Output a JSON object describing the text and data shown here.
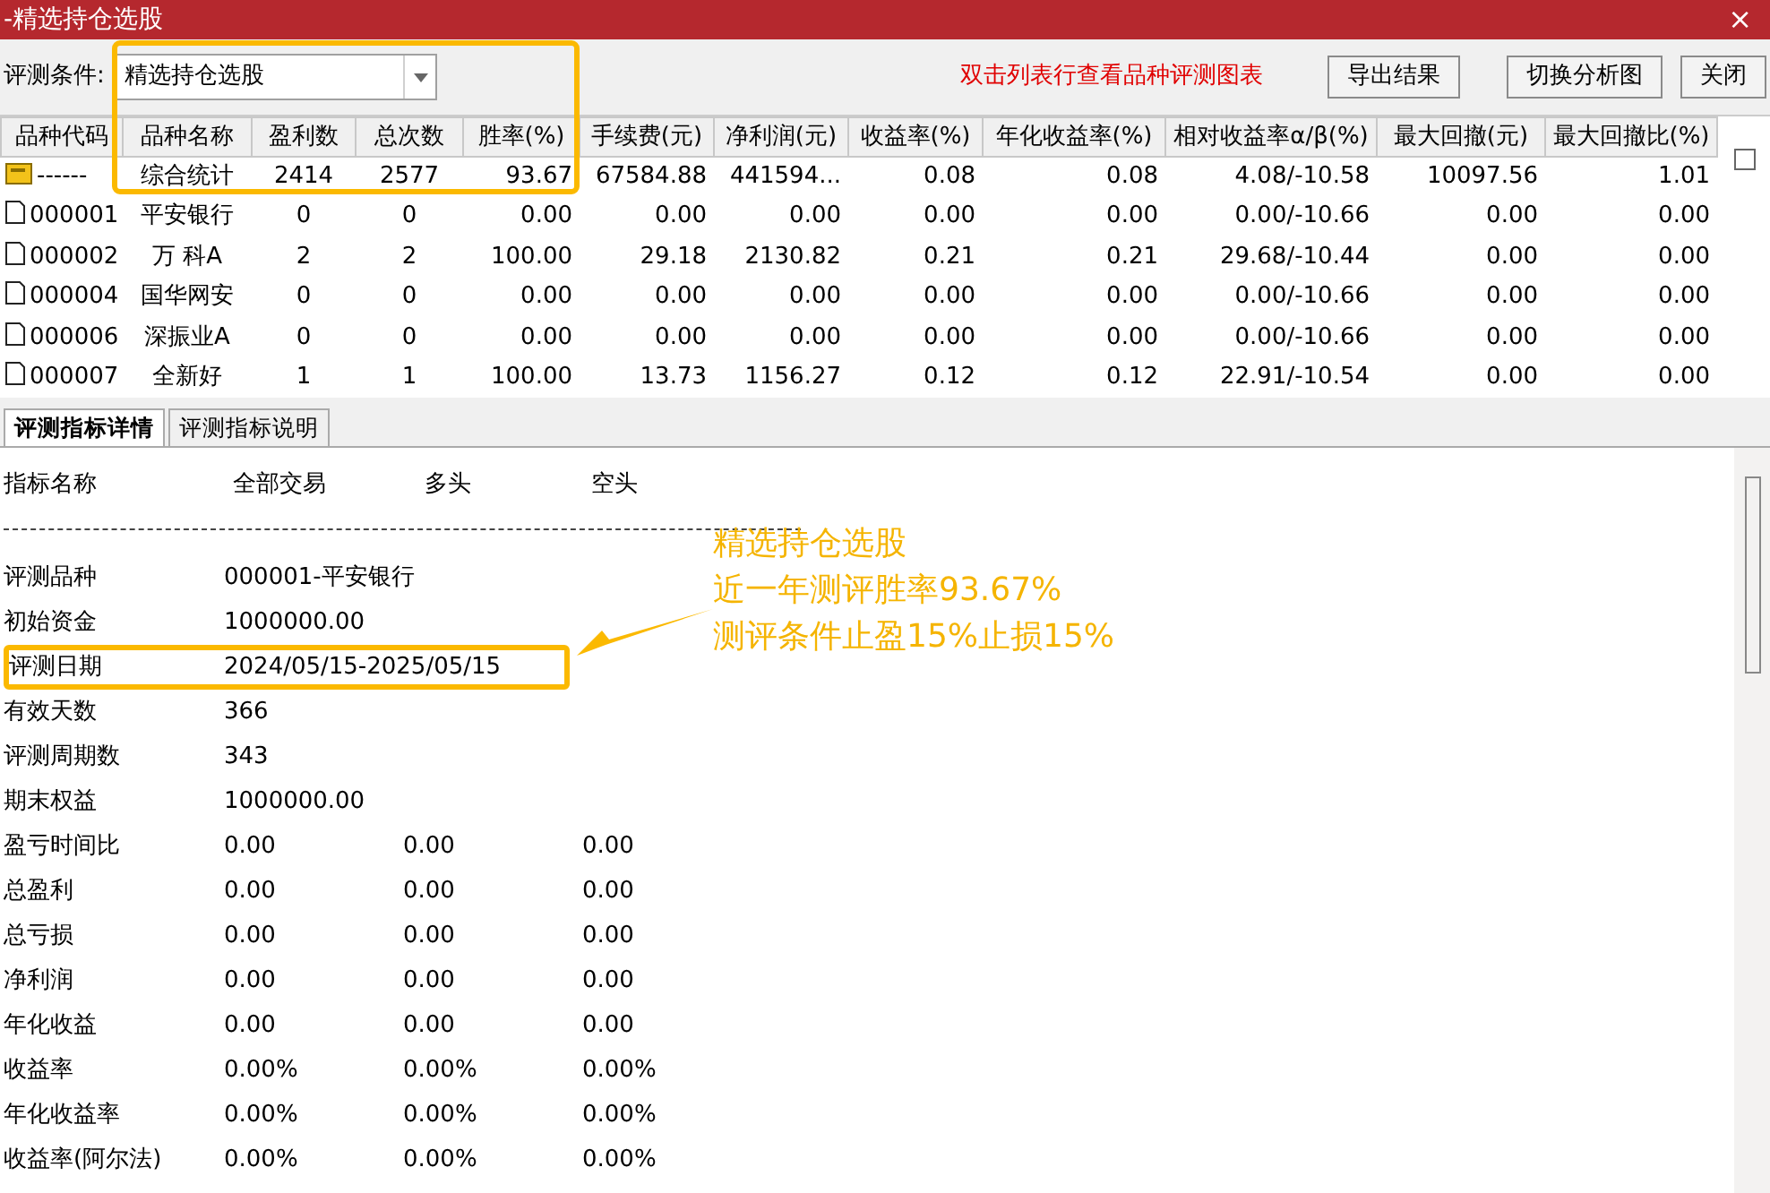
{
  "window": {
    "title": "-精选持仓选股",
    "close": "×"
  },
  "toolbar": {
    "condition_label": "评测条件:",
    "condition_value": "精选持仓选股",
    "hint": "双击列表行查看品种评测图表",
    "buttons": [
      "导出结果",
      "切换分析图",
      "关闭"
    ]
  },
  "table": {
    "columns": [
      "品种代码",
      "品种名称",
      "盈利数",
      "总次数",
      "胜率(%)",
      "手续费(元)",
      "净利润(元)",
      "收益率(%)",
      "年化收益率(%)",
      "相对收益率α/β(%)",
      "最大回撤(元)",
      "最大回撤比(%)"
    ],
    "checkbox_checked": false,
    "rows": [
      {
        "kind": "summary",
        "cells": [
          "------",
          "综合统计",
          "2414",
          "2577",
          "93.67",
          "67584.88",
          "441594...",
          "0.08",
          "0.08",
          "4.08/-10.58",
          "10097.56",
          "1.01"
        ]
      },
      {
        "kind": "stock",
        "cells": [
          "000001",
          "平安银行",
          "0",
          "0",
          "0.00",
          "0.00",
          "0.00",
          "0.00",
          "0.00",
          "0.00/-10.66",
          "0.00",
          "0.00"
        ]
      },
      {
        "kind": "stock",
        "cells": [
          "000002",
          "万 科A",
          "2",
          "2",
          "100.00",
          "29.18",
          "2130.82",
          "0.21",
          "0.21",
          "29.68/-10.44",
          "0.00",
          "0.00"
        ]
      },
      {
        "kind": "stock",
        "cells": [
          "000004",
          "国华网安",
          "0",
          "0",
          "0.00",
          "0.00",
          "0.00",
          "0.00",
          "0.00",
          "0.00/-10.66",
          "0.00",
          "0.00"
        ]
      },
      {
        "kind": "stock",
        "cells": [
          "000006",
          "深振业A",
          "0",
          "0",
          "0.00",
          "0.00",
          "0.00",
          "0.00",
          "0.00",
          "0.00/-10.66",
          "0.00",
          "0.00"
        ]
      },
      {
        "kind": "stock",
        "cells": [
          "000007",
          "全新好",
          "1",
          "1",
          "100.00",
          "13.73",
          "1156.27",
          "0.12",
          "0.12",
          "22.91/-10.54",
          "0.00",
          "0.00"
        ]
      }
    ]
  },
  "tabs": [
    {
      "label": "评测指标详情",
      "selected": true
    },
    {
      "label": "评测指标说明",
      "selected": false
    }
  ],
  "details": {
    "header": [
      "指标名称",
      "全部交易",
      "多头",
      "空头"
    ],
    "rows": [
      {
        "label": "评测品种",
        "values": [
          "000001-平安银行"
        ]
      },
      {
        "label": "初始资金",
        "values": [
          "1000000.00"
        ]
      },
      {
        "label": "评测日期",
        "values": [
          "2024/05/15-2025/05/15"
        ],
        "highlighted": true
      },
      {
        "label": "有效天数",
        "values": [
          "366"
        ]
      },
      {
        "label": "评测周期数",
        "values": [
          "343"
        ]
      },
      {
        "label": "期末权益",
        "values": [
          "1000000.00"
        ]
      },
      {
        "label": "盈亏时间比",
        "values": [
          "0.00",
          "0.00",
          "0.00"
        ]
      },
      {
        "label": "总盈利",
        "values": [
          "0.00",
          "0.00",
          "0.00"
        ]
      },
      {
        "label": "总亏损",
        "values": [
          "0.00",
          "0.00",
          "0.00"
        ]
      },
      {
        "label": "净利润",
        "values": [
          "0.00",
          "0.00",
          "0.00"
        ]
      },
      {
        "label": "年化收益",
        "values": [
          "0.00",
          "0.00",
          "0.00"
        ]
      },
      {
        "label": "收益率",
        "values": [
          "0.00%",
          "0.00%",
          "0.00%"
        ]
      },
      {
        "label": "年化收益率",
        "values": [
          "0.00%",
          "0.00%",
          "0.00%"
        ]
      },
      {
        "label": "收益率(阿尔法)",
        "values": [
          "0.00%",
          "0.00%",
          "0.00%"
        ]
      }
    ]
  },
  "annotation": {
    "lines": [
      "精选持仓选股",
      "近一年测评胜率93.67%",
      "测评条件止盈15%止损15%"
    ]
  }
}
